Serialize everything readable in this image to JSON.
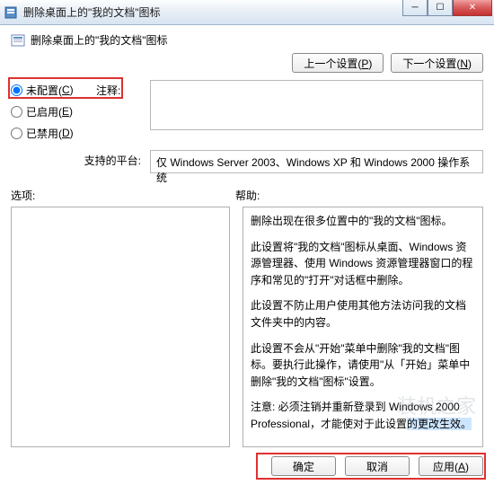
{
  "titlebar": {
    "title": "删除桌面上的\"我的文档\"图标"
  },
  "description": "删除桌面上的\"我的文档\"图标",
  "nav": {
    "prev": "上一个设置(",
    "prev_u": "P",
    "prev_end": ")",
    "next": "下一个设置(",
    "next_u": "N",
    "next_end": ")"
  },
  "radios": {
    "unconfigured": "未配置(",
    "unconfigured_u": "C",
    "unconfigured_end": ")",
    "enabled": "已启用(",
    "enabled_u": "E",
    "enabled_end": ")",
    "disabled": "已禁用(",
    "disabled_u": "D",
    "disabled_end": ")"
  },
  "comment_label": "注释:",
  "platform_label": "支持的平台:",
  "platform_text": "仅 Windows Server 2003、Windows XP 和 Windows 2000 操作系统",
  "options_label": "选项:",
  "help_label": "帮助:",
  "help": {
    "p1": "删除出现在很多位置中的\"我的文档\"图标。",
    "p2": "此设置将\"我的文档\"图标从桌面、Windows 资源管理器、使用 Windows 资源管理器窗口的程序和常见的\"打开\"对话框中删除。",
    "p3": "此设置不防止用户使用其他方法访问我的文档文件夹中的内容。",
    "p4": "此设置不会从\"开始\"菜单中删除\"我的文档\"图标。要执行此操作，请使用\"从「开始」菜单中删除\"我的文档\"图标\"设置。",
    "p5a": "注意: 必须注销并重新登录到 Windows 2000 Professional，才能使对于此设置",
    "p5b": "的更改生效。"
  },
  "footer": {
    "ok": "确定",
    "cancel": "取消",
    "apply": "应用(",
    "apply_u": "A",
    "apply_end": ")"
  },
  "watermark": "装机之家"
}
